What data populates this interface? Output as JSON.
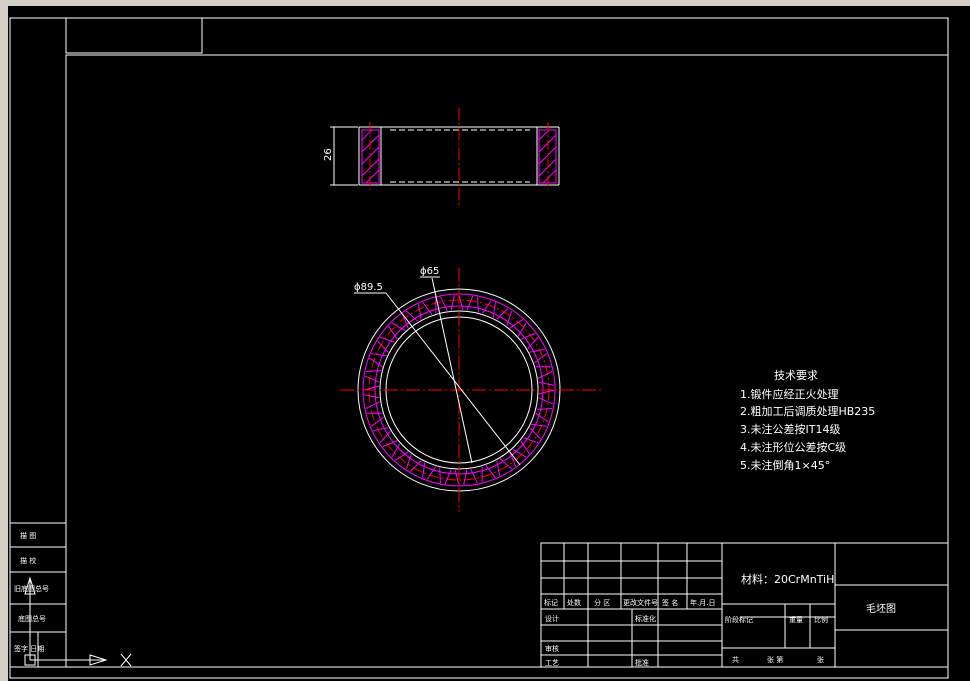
{
  "drawing": {
    "dim_height": "26",
    "dim_outer": "ϕ89.5",
    "dim_inner": "ϕ65",
    "tech_title": "技术要求",
    "tech_items": [
      "1.锻件应经正火处理",
      "2.粗加工后调质处理HB235",
      "3.未注公差按IT14级",
      "4.未注形位公差按C级",
      "5.未注倒角1×45°"
    ]
  },
  "title_block": {
    "material": "材料：20CrMnTiH",
    "drawing_name": "毛坯图",
    "row_headers": [
      "标记",
      "处数",
      "分 区",
      "更改文件号",
      "签 名",
      "年.月.日"
    ],
    "design": "设计",
    "standardize": "标准化",
    "review": "审核",
    "process": "工艺",
    "approve": "批准",
    "stage_mark": "阶段标记",
    "weight": "重量",
    "scale": "比例",
    "total": "共",
    "sheets": "张 第",
    "sheet": "张"
  },
  "side_block": {
    "labels": [
      "描 图",
      "描 校",
      "旧底图总号",
      "底图总号",
      "签字 日期"
    ]
  },
  "ucs": {
    "x_label": "X"
  },
  "colors": {
    "background": "#000000",
    "lines": "#ffffff",
    "centerline": "#ff0000",
    "hatch": "#ff00ff"
  }
}
